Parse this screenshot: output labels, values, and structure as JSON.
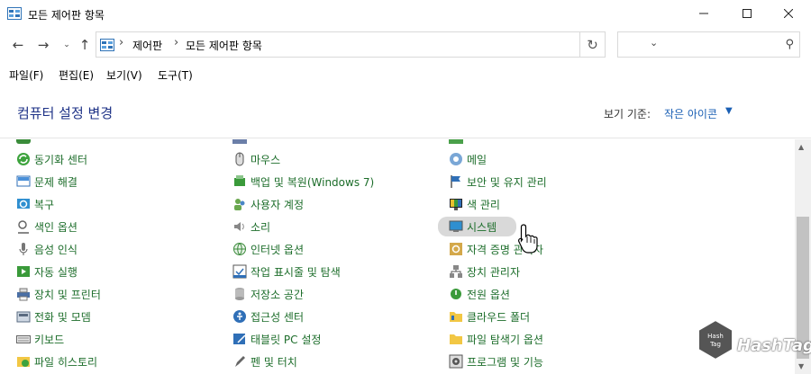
{
  "window": {
    "title": "모든 제어판 항목",
    "controls": {
      "minimize_icon": "minimize-icon",
      "maximize_icon": "maximize-icon",
      "close_icon": "close-icon"
    }
  },
  "nav": {
    "breadcrumb": [
      "제어판",
      "모든 제어판 항목"
    ],
    "search_placeholder": ""
  },
  "menu": [
    "파일(F)",
    "편집(E)",
    "보기(V)",
    "도구(T)"
  ],
  "header": {
    "title": "컴퓨터 설정 변경",
    "view_label": "보기 기준:",
    "view_value": "작은 아이콘"
  },
  "items": {
    "col1": [
      "동기화 센터",
      "문제 해결",
      "복구",
      "색인 옵션",
      "음성 인식",
      "자동 실행",
      "장치 및 프린터",
      "전화 및 모뎀",
      "키보드",
      "파일 히스토리"
    ],
    "col2": [
      "마우스",
      "백업 및 복원(Windows 7)",
      "사용자 계정",
      "소리",
      "인터넷 옵션",
      "작업 표시줄 및 탐색",
      "저장소 공간",
      "접근성 센터",
      "태블릿 PC 설정",
      "펜 및 터치"
    ],
    "col3": [
      "메일",
      "보안 및 유지 관리",
      "색 관리",
      "시스템",
      "자격 증명 관리자",
      "장치 관리자",
      "전원 옵션",
      "클라우드 폴더",
      "파일 탐색기 옵션",
      "프로그램 및 기능"
    ]
  },
  "hovered_item": "시스템",
  "watermark": "HashTag",
  "colors": {
    "link_green": "#1c6d2a",
    "header_blue": "#1e3287",
    "accent_blue": "#1a5fb4"
  }
}
